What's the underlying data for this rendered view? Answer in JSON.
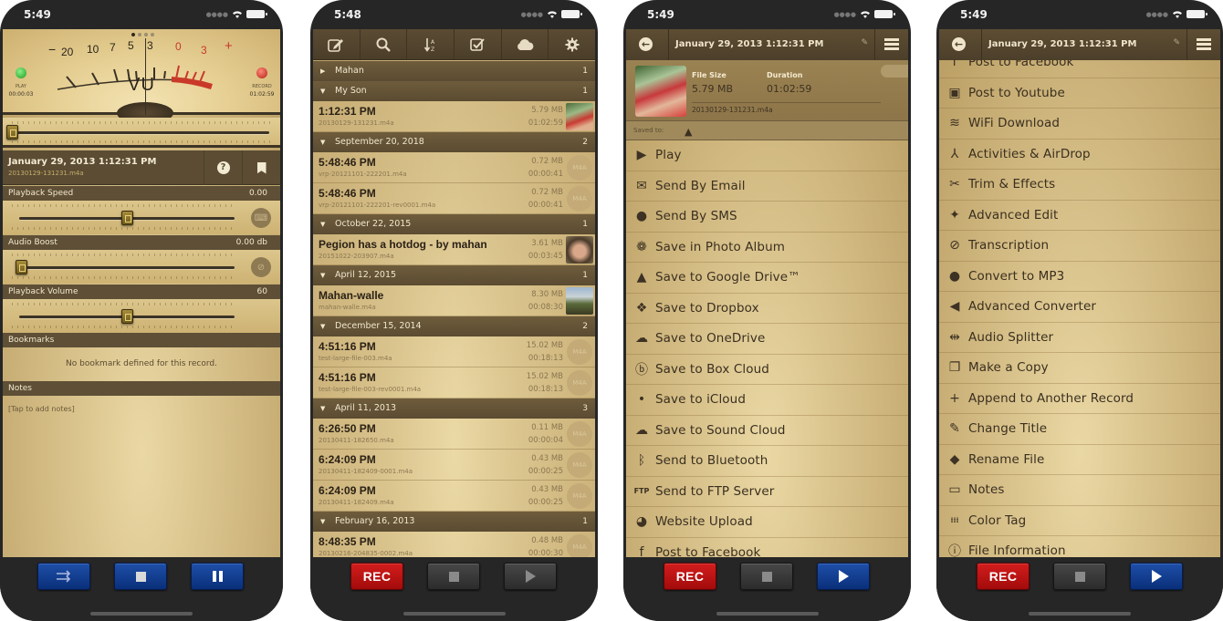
{
  "phones": [
    {
      "status_time": "5:49",
      "vu": {
        "scale_labels": [
          "−",
          "20",
          "10",
          "7",
          "5",
          "3",
          "0",
          "3",
          "+"
        ],
        "meter_label": "VU",
        "play_label": "PLAY",
        "play_time": "00:00:03",
        "record_label": "RECORD",
        "record_time": "01:02:59"
      },
      "progress": 0.0,
      "record_title": "January 29, 2013 1:12:31 PM",
      "record_file": "20130129-131231.m4a",
      "playback_speed": {
        "label": "Playback Speed",
        "value": "0.00",
        "position": 0.5
      },
      "audio_boost": {
        "label": "Audio Boost",
        "value": "0.00 db",
        "position": 0.0
      },
      "playback_volume": {
        "label": "Playback Volume",
        "value": "60",
        "position": 0.5
      },
      "bookmarks": {
        "label": "Bookmarks",
        "empty_text": "No bookmark defined for this record."
      },
      "notes": {
        "label": "Notes",
        "placeholder": "[Tap to add notes]"
      }
    },
    {
      "status_time": "5:48",
      "toolbar": [
        "edit-icon",
        "search-icon",
        "sort-az-icon",
        "checkbox-icon",
        "cloud-icon",
        "gear-icon"
      ],
      "groups": [
        {
          "title": "Mahan",
          "count": "1",
          "expanded": false,
          "rows": []
        },
        {
          "title": "My Son",
          "count": "1",
          "expanded": true,
          "rows": [
            {
              "title": "1:12:31 PM",
              "file": "20130129-131231.m4a",
              "size": "5.79 MB",
              "duration": "01:02:59",
              "thumb": "boy"
            }
          ]
        },
        {
          "title": "September 20, 2018",
          "count": "2",
          "expanded": true,
          "rows": [
            {
              "title": "5:48:46 PM",
              "file": "vrp-20121101-222201.m4a",
              "size": "0.72 MB",
              "duration": "00:00:41",
              "thumb": "M4A"
            },
            {
              "title": "5:48:46 PM",
              "file": "vrp-20121101-222201-rev0001.m4a",
              "size": "0.72 MB",
              "duration": "00:00:41",
              "thumb": "M4A"
            }
          ]
        },
        {
          "title": "October 22, 2015",
          "count": "1",
          "expanded": true,
          "rows": [
            {
              "title": "Pegion has a hotdog - by mahan",
              "file": "20151022-203907.m4a",
              "size": "3.61 MB",
              "duration": "00:03:45",
              "thumb": "face"
            }
          ]
        },
        {
          "title": "April 12, 2015",
          "count": "1",
          "expanded": true,
          "rows": [
            {
              "title": "Mahan-walle",
              "file": "mahan-walle.m4a",
              "size": "8.30 MB",
              "duration": "00:08:30",
              "thumb": "land"
            }
          ]
        },
        {
          "title": "December 15, 2014",
          "count": "2",
          "expanded": true,
          "rows": [
            {
              "title": "4:51:16 PM",
              "file": "test-large-file-003.m4a",
              "size": "15.02 MB",
              "duration": "00:18:13",
              "thumb": "M4A"
            },
            {
              "title": "4:51:16 PM",
              "file": "test-large-file-003-rev0001.m4a",
              "size": "15.02 MB",
              "duration": "00:18:13",
              "thumb": "M4A"
            }
          ]
        },
        {
          "title": "April 11, 2013",
          "count": "3",
          "expanded": true,
          "rows": [
            {
              "title": "6:26:50 PM",
              "file": "20130411-182650.m4a",
              "size": "0.11 MB",
              "duration": "00:00:04",
              "thumb": "M4A"
            },
            {
              "title": "6:24:09 PM",
              "file": "20130411-182409-0001.m4a",
              "size": "0.43 MB",
              "duration": "00:00:25",
              "thumb": "M4A"
            },
            {
              "title": "6:24:09 PM",
              "file": "20130411-182409.m4a",
              "size": "0.43 MB",
              "duration": "00:00:25",
              "thumb": "M4A"
            }
          ]
        },
        {
          "title": "February 16, 2013",
          "count": "1",
          "expanded": true,
          "rows": [
            {
              "title": "8:48:35 PM",
              "file": "20130216-204835-0002.m4a",
              "size": "0.48 MB",
              "duration": "00:00:30",
              "thumb": "M4A"
            }
          ]
        }
      ]
    },
    {
      "status_time": "5:49",
      "header_title": "January 29, 2013 1:12:31 PM",
      "file_size_label": "File Size",
      "file_size": "5.79 MB",
      "duration_label": "Duration",
      "duration": "01:02:59",
      "file_name": "20130129-131231.m4a",
      "saved_to_label": "Saved to:",
      "menu": [
        {
          "icon": "play-circle-icon",
          "label": "Play"
        },
        {
          "icon": "email-icon",
          "label": "Send By Email"
        },
        {
          "icon": "sms-bubble-icon",
          "label": "Send By SMS"
        },
        {
          "icon": "photo-album-icon",
          "label": "Save in Photo Album"
        },
        {
          "icon": "google-drive-icon",
          "label": "Save to Google Drive™"
        },
        {
          "icon": "dropbox-icon",
          "label": "Save to Dropbox"
        },
        {
          "icon": "onedrive-icon",
          "label": "Save to OneDrive"
        },
        {
          "icon": "box-icon",
          "label": "Save to Box Cloud"
        },
        {
          "icon": "icloud-icon",
          "label": "Save to iCloud"
        },
        {
          "icon": "soundcloud-icon",
          "label": "Save to Sound Cloud"
        },
        {
          "icon": "bluetooth-icon",
          "label": "Send to Bluetooth"
        },
        {
          "icon": "ftp-icon",
          "label": "Send to FTP Server"
        },
        {
          "icon": "globe-icon",
          "label": "Website Upload"
        },
        {
          "icon": "facebook-icon",
          "label": "Post to Facebook"
        }
      ]
    },
    {
      "status_time": "5:49",
      "header_title": "January 29, 2013 1:12:31 PM",
      "menu": [
        {
          "icon": "facebook-icon",
          "label": "Post to Facebook"
        },
        {
          "icon": "youtube-icon",
          "label": "Post to Youtube"
        },
        {
          "icon": "wifi-icon",
          "label": "WiFi Download"
        },
        {
          "icon": "airdrop-icon",
          "label": "Activities & AirDrop"
        },
        {
          "icon": "scissors-icon",
          "label": "Trim & Effects"
        },
        {
          "icon": "waveform-icon",
          "label": "Advanced Edit"
        },
        {
          "icon": "transcription-icon",
          "label": "Transcription"
        },
        {
          "icon": "mp3-icon",
          "label": "Convert to MP3"
        },
        {
          "icon": "converter-icon",
          "label": "Advanced Converter"
        },
        {
          "icon": "splitter-icon",
          "label": "Audio Splitter"
        },
        {
          "icon": "copy-icon",
          "label": "Make a Copy"
        },
        {
          "icon": "append-icon",
          "label": "Append to Another Record"
        },
        {
          "icon": "pencil-icon",
          "label": "Change Title"
        },
        {
          "icon": "tag-icon",
          "label": "Rename File"
        },
        {
          "icon": "notes-icon",
          "label": "Notes"
        },
        {
          "icon": "color-grid-icon",
          "label": "Color Tag"
        },
        {
          "icon": "info-icon",
          "label": "File Information"
        }
      ]
    }
  ],
  "transport": {
    "rec_label": "REC"
  },
  "colors": {
    "accent_blue": "#0a2f7a",
    "rec_red": "#c01414",
    "header_brown": "#5b4c33",
    "parchment": "#dcc68c"
  }
}
